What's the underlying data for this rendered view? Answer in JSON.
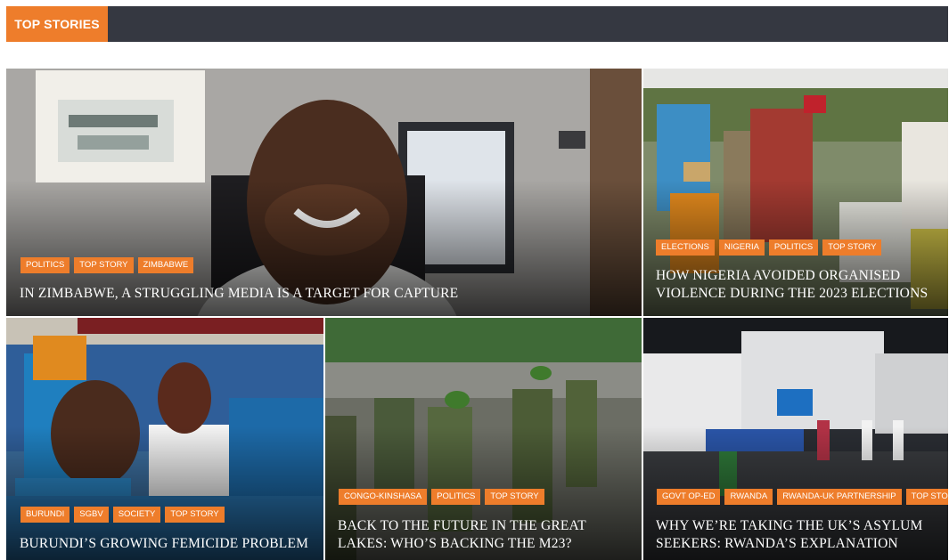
{
  "section": {
    "label": "TOP STORIES"
  },
  "colors": {
    "accent": "#ee7d2b",
    "bar": "#353841"
  },
  "stories": [
    {
      "tags": [
        "POLITICS",
        "TOP STORY",
        "ZIMBABWE"
      ],
      "title": "IN ZIMBABWE, A STRUGGLING MEDIA IS A TARGET FOR CAPTURE"
    },
    {
      "tags": [
        "ELECTIONS",
        "NIGERIA",
        "POLITICS",
        "TOP STORY"
      ],
      "title": "HOW NIGERIA AVOIDED ORGANISED VIOLENCE DURING THE 2023 ELECTIONS"
    },
    {
      "tags": [
        "BURUNDI",
        "SGBV",
        "SOCIETY",
        "TOP STORY"
      ],
      "title": "BURUNDI’S GROWING FEMICIDE PROBLEM"
    },
    {
      "tags": [
        "CONGO-KINSHASA",
        "POLITICS",
        "TOP STORY"
      ],
      "title": "BACK TO THE FUTURE IN THE GREAT LAKES: WHO’S BACKING THE M23?"
    },
    {
      "tags": [
        "GOVT OP-ED",
        "RWANDA",
        "RWANDA-UK PARTNERSHIP",
        "TOP STORY"
      ],
      "title": "WHY WE’RE TAKING THE UK’S ASYLUM SEEKERS: RWANDA’S EXPLANATION"
    }
  ]
}
